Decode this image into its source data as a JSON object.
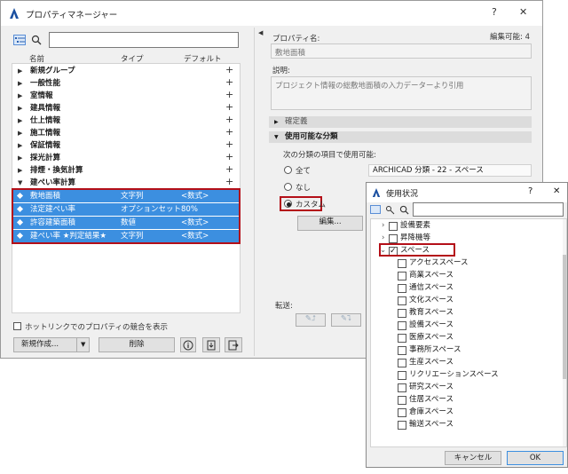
{
  "main_window": {
    "title": "プロパティマネージャー",
    "help_btn": "?",
    "close_btn": "✕",
    "search_placeholder": "",
    "columns": {
      "name": "名前",
      "type": "タイプ",
      "default": "デフォルト"
    },
    "groups": [
      {
        "label": "新規グループ"
      },
      {
        "label": "一般性能"
      },
      {
        "label": "室情報"
      },
      {
        "label": "建具情報"
      },
      {
        "label": "仕上情報"
      },
      {
        "label": "施工情報"
      },
      {
        "label": "保証情報"
      },
      {
        "label": "採光計算"
      },
      {
        "label": "排煙・換気計算"
      },
      {
        "label": "建ぺい率計算"
      }
    ],
    "properties": [
      {
        "name": "敷地面積",
        "type": "文字列",
        "default": "<数式>"
      },
      {
        "name": "法定建ぺい率",
        "type": "オプションセット",
        "default": "80%"
      },
      {
        "name": "許容建築面積",
        "type": "数値",
        "default": "<数式>"
      },
      {
        "name": "建ぺい率 ★判定結果★",
        "type": "文字列",
        "default": "<数式>"
      }
    ],
    "hotlink_checkbox": "ホットリンクでのプロパティの競合を表示",
    "new_button": "新規作成...",
    "delete_button": "削除",
    "editable_label": "編集可能: 4",
    "property_name_label": "プロパティ名:",
    "property_name_value": "敷地面積",
    "description_label": "説明:",
    "description_value": "プロジェクト情報の総敷地面積の入力データーより引用",
    "section_definition": "確定義",
    "section_classification": "使用可能な分類",
    "available_label": "次の分類の項目で使用可能:",
    "radio_all": "全て",
    "radio_none": "なし",
    "radio_custom": "カスタム",
    "classification_value": "ARCHICAD 分類 - 22 - スペース",
    "edit_button": "編集...",
    "transfer_label": "転送:"
  },
  "usage_dialog": {
    "title": "使用状況",
    "help_btn": "?",
    "close_btn": "✕",
    "items": [
      {
        "label": "設備要素",
        "level": 1,
        "checked": false,
        "arrow": "›"
      },
      {
        "label": "昇降機等",
        "level": 1,
        "checked": false,
        "arrow": "›"
      },
      {
        "label": "スペース",
        "level": 1,
        "checked": true,
        "arrow": "⌄"
      },
      {
        "label": "アクセススペース",
        "level": 2,
        "checked": false
      },
      {
        "label": "商業スペース",
        "level": 2,
        "checked": false
      },
      {
        "label": "通信スペース",
        "level": 2,
        "checked": false
      },
      {
        "label": "文化スペース",
        "level": 2,
        "checked": false
      },
      {
        "label": "教育スペース",
        "level": 2,
        "checked": false
      },
      {
        "label": "設備スペース",
        "level": 2,
        "checked": false
      },
      {
        "label": "医療スペース",
        "level": 2,
        "checked": false
      },
      {
        "label": "事務所スペース",
        "level": 2,
        "checked": false
      },
      {
        "label": "生産スペース",
        "level": 2,
        "checked": false
      },
      {
        "label": "リクリエーションスペース",
        "level": 2,
        "checked": false
      },
      {
        "label": "研究スペース",
        "level": 2,
        "checked": false
      },
      {
        "label": "住居スペース",
        "level": 2,
        "checked": false
      },
      {
        "label": "倉庫スペース",
        "level": 2,
        "checked": false
      },
      {
        "label": "輸送スペース",
        "level": 2,
        "checked": false
      }
    ],
    "cancel_button": "キャンセル",
    "ok_button": "OK"
  },
  "colors": {
    "selection": "#3c8fe0",
    "highlight": "#b40f18"
  }
}
